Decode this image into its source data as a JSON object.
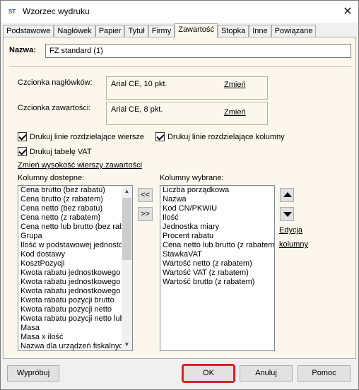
{
  "window": {
    "app_icon": "ST",
    "title": "Wzorzec wydruku",
    "close_glyph": "✕"
  },
  "tabs": [
    "Podstawowe",
    "Nagłówek",
    "Papier",
    "Tytuł",
    "Firmy",
    "Zawartość",
    "Stopka",
    "Inne",
    "Powiązane"
  ],
  "active_tab": "Zawartość",
  "name": {
    "label": "Nazwa:",
    "value": "FZ standard (1)"
  },
  "fonts": {
    "header_label": "Czcionka nagłówków:",
    "header_value": "Arial CE, 10 pkt.",
    "content_label": "Czcionka zawartości:",
    "content_value": "Arial CE, 8 pkt.",
    "change_link": "Zmień"
  },
  "checkboxes": {
    "row_lines": "Drukuj linie rozdzielające wiersze",
    "col_lines": "Drukuj linie rozdzielające kolumny",
    "vat_table": "Drukuj tabelę VAT"
  },
  "row_height_link": "Zmień wysokość wierszy zawartości",
  "available": {
    "label": "Kolumny dostepne:",
    "items": [
      "Cena brutto (bez rabatu)",
      "Cena brutto (z rabatem)",
      "Cena netto (bez rabatu)",
      "Cena netto (z rabatem)",
      "Cena netto lub brutto (bez rabatu)",
      "Grupa",
      "Ilość w podstawowej jednostce",
      "Kod dostawy",
      "KosztPozycji",
      "Kwota rabatu jednostkowego",
      "Kwota rabatu jednostkowego",
      "Kwota rabatu jednostkowego",
      "Kwota rabatu pozycji brutto",
      "Kwota rabatu pozycji netto",
      "Kwota rabatu pozycji netto lub",
      "Masa",
      "Masa x ilość",
      "Nazwa dla urządzeń fiskalnych"
    ]
  },
  "move_buttons": {
    "left": "<<",
    "right": ">>"
  },
  "selected": {
    "label": "Kolumny wybrane:",
    "items": [
      "Liczba porządkowa",
      "Nazwa",
      "Kod CN/PKWiU",
      "Ilość",
      "Jednostka miary",
      "Procent rabatu",
      "Cena netto lub brutto (z rabatem)",
      "StawkaVAT",
      "Wartość netto (z rabatem)",
      "Wartość VAT (z rabatem)",
      "Wartość brutto (z rabatem)"
    ]
  },
  "edit_column_link": [
    "Edycja",
    "kolumny"
  ],
  "buttons": {
    "preview": "Wypróbuj",
    "ok": "OK",
    "cancel": "Anuluj",
    "help": "Pomoc"
  }
}
